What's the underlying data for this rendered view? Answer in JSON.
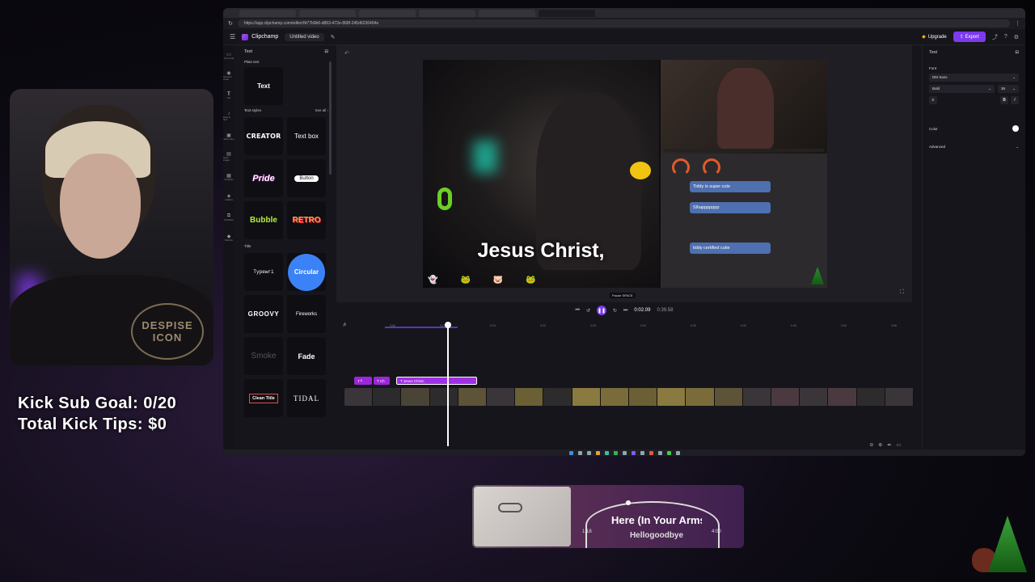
{
  "overlay": {
    "sub_goal": "Kick Sub Goal: 0/20",
    "tips": "Total Kick Tips: $0",
    "shirt_text": "DESPISE ICON"
  },
  "browser": {
    "tabs": [
      "",
      "",
      "",
      "",
      "",
      ""
    ],
    "url": "https://app.clipchamp.com/editor/fd77b9b6-d863-472e-868f-245d6236404e"
  },
  "app": {
    "brand": "Clipchamp",
    "doc_title": "Untitled video",
    "upgrade_label": "Upgrade",
    "export_label": "Export",
    "rail": [
      {
        "icon": "media-icon",
        "label": "Your media"
      },
      {
        "icon": "record-icon",
        "label": "Record & create"
      },
      {
        "icon": "text-icon",
        "label": "Text"
      },
      {
        "icon": "music-icon",
        "label": "Music & SFX"
      },
      {
        "icon": "stock-video-icon",
        "label": "Stock video"
      },
      {
        "icon": "stock-images-icon",
        "label": "Stock images"
      },
      {
        "icon": "templates-icon",
        "label": "Templates"
      },
      {
        "icon": "graphics-icon",
        "label": "Graphics"
      },
      {
        "icon": "transitions-icon",
        "label": "Transitions"
      },
      {
        "icon": "brand-kit-icon",
        "label": "Brand kit"
      }
    ]
  },
  "panel": {
    "title": "Text",
    "plain_text_heading": "Plain text",
    "plain_text_tile": "Text",
    "text_styles_heading": "Text styles",
    "see_all": "See all",
    "styles": [
      "CREATOR",
      "Text box",
      "Pride",
      "Button",
      "Bubble",
      "RETRO"
    ],
    "title_heading": "Title",
    "titles": [
      "Typewri",
      "Circular",
      "GROOVY",
      "Fireworks",
      "Smoke",
      "Fade",
      "Clean Title",
      "TIDAL"
    ]
  },
  "stage": {
    "caption": "Jesus Christ,",
    "chat_lines": [
      "Tiddy is super cute",
      "Slhappppppp",
      "tiddy certified cutie"
    ]
  },
  "controls": {
    "tooltip": "Pause  SPACE",
    "current_time": "0:02.09",
    "total_time": "0:39.58"
  },
  "timeline": {
    "ruler_labels": [
      "0",
      "0:05",
      "0:10",
      "0:15",
      "0:20",
      "0:25",
      "0:30",
      "0:35",
      "0:40",
      "0:45",
      "0:50",
      "0:55"
    ],
    "text_clips": [
      "T ᴮ",
      "T Ch",
      "T  Jesus Christ,"
    ]
  },
  "props": {
    "title": "Text",
    "font_label": "Font",
    "font_value": "DM Sans",
    "weight_value": "Bold",
    "size_value": "36",
    "color_label": "Color",
    "advanced_label": "Advanced"
  },
  "nowplaying": {
    "title": "Here (In Your Arms)",
    "artist": "Hellogoodbye",
    "elapsed": "1:18",
    "duration": "4:00"
  }
}
